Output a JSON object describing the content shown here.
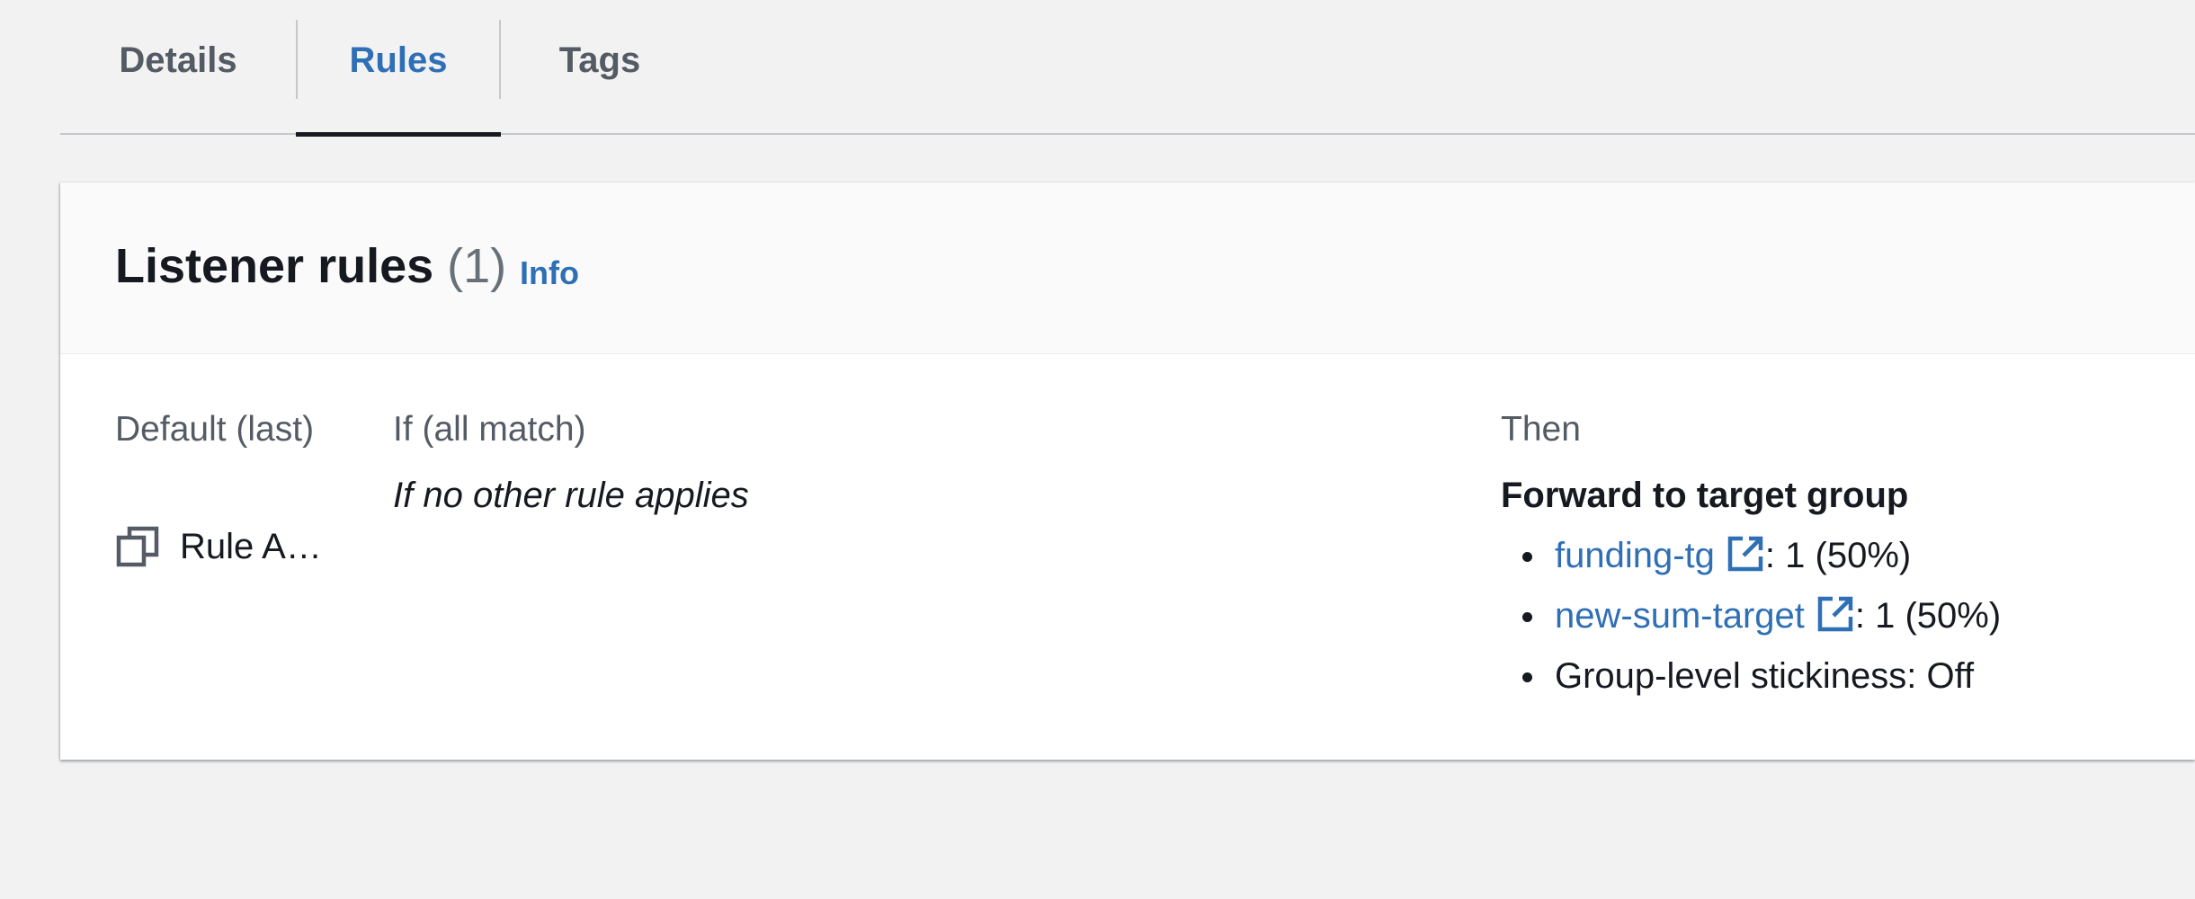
{
  "tabs": [
    {
      "label": "Details"
    },
    {
      "label": "Rules"
    },
    {
      "label": "Tags"
    }
  ],
  "listener_rules": {
    "title": "Listener rules",
    "count": "(1)",
    "info_label": "Info"
  },
  "rule": {
    "priority_label": "Default (last)",
    "arn_label": "Rule A…",
    "condition_header": "If (all match)",
    "condition_text": "If no other rule applies",
    "then_header": "Then",
    "action_title": "Forward to target group",
    "targets": [
      {
        "name": "funding-tg",
        "weight": ": 1 (50%)"
      },
      {
        "name": "new-sum-target",
        "weight": ": 1 (50%)"
      }
    ],
    "stickiness": "Group-level stickiness: Off"
  },
  "colors": {
    "link": "#2f6fb5",
    "background": "#f2f2f2",
    "text": "#16191f"
  }
}
